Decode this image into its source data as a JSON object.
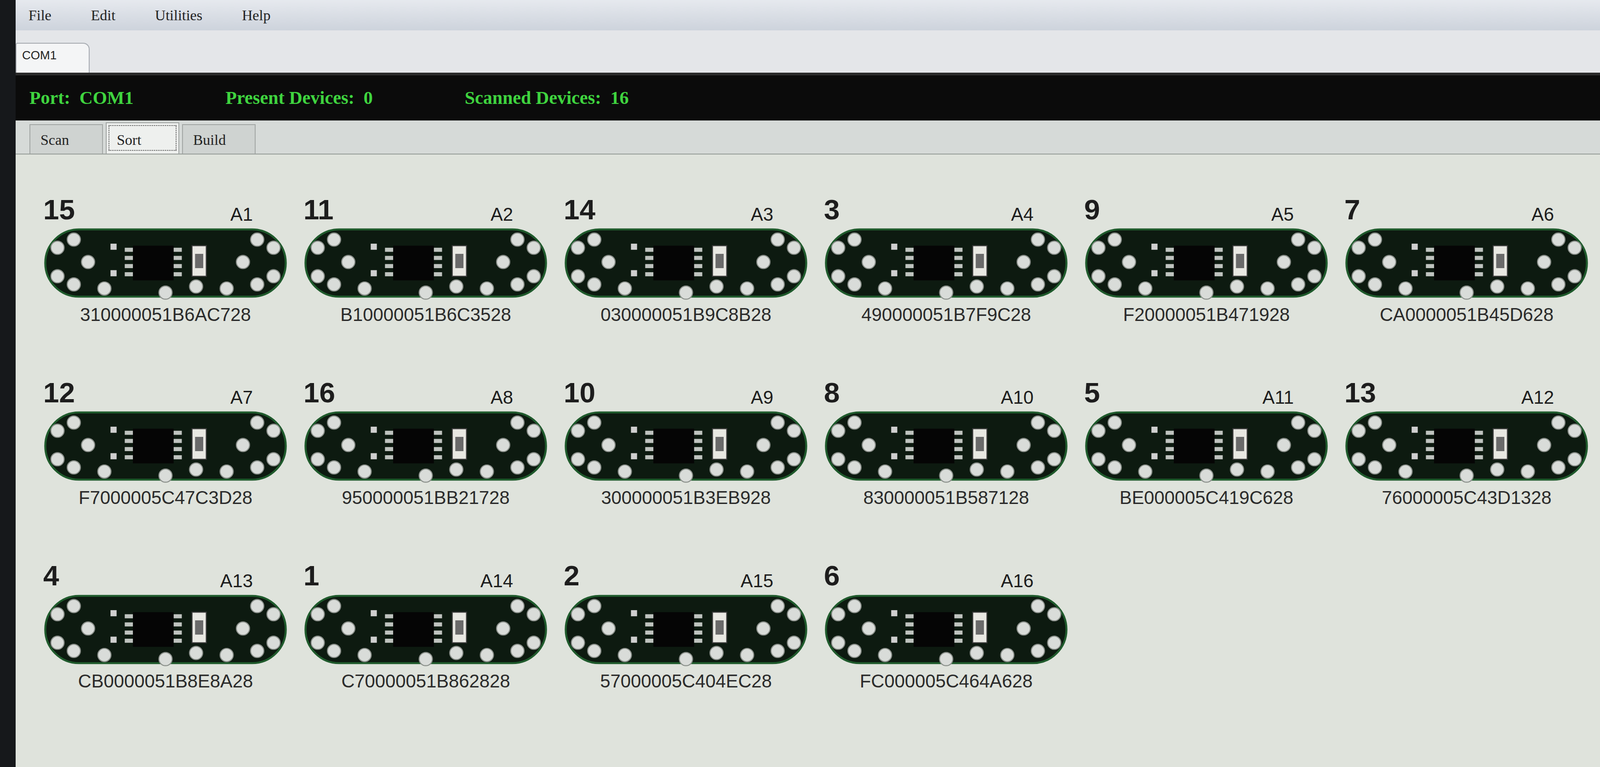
{
  "menu": [
    "File",
    "Edit",
    "Utilities",
    "Help"
  ],
  "port_tabs": [
    {
      "label": "COM1",
      "selected": true
    }
  ],
  "status_bar": [
    {
      "label": "Port:",
      "value": "COM1"
    },
    {
      "label": "Present Devices:",
      "value": "0"
    },
    {
      "label": "Scanned Devices:",
      "value": "16"
    }
  ],
  "tabs": [
    {
      "label": "Scan",
      "selected": false
    },
    {
      "label": "Sort",
      "selected": true
    },
    {
      "label": "Build",
      "selected": false
    }
  ],
  "devices": [
    {
      "number": "15",
      "slot": "A1",
      "id": "310000051B6AC728"
    },
    {
      "number": "11",
      "slot": "A2",
      "id": "B10000051B6C3528"
    },
    {
      "number": "14",
      "slot": "A3",
      "id": "030000051B9C8B28"
    },
    {
      "number": "3",
      "slot": "A4",
      "id": "490000051B7F9C28"
    },
    {
      "number": "9",
      "slot": "A5",
      "id": "F20000051B471928"
    },
    {
      "number": "7",
      "slot": "A6",
      "id": "CA0000051B45D628"
    },
    {
      "number": "12",
      "slot": "A7",
      "id": "F7000005C47C3D28"
    },
    {
      "number": "16",
      "slot": "A8",
      "id": "950000051BB21728"
    },
    {
      "number": "10",
      "slot": "A9",
      "id": "300000051B3EB928"
    },
    {
      "number": "8",
      "slot": "A10",
      "id": "830000051B587128"
    },
    {
      "number": "5",
      "slot": "A11",
      "id": "BE000005C419C628"
    },
    {
      "number": "13",
      "slot": "A12",
      "id": "76000005C43D1328"
    },
    {
      "number": "4",
      "slot": "A13",
      "id": "CB0000051B8E8A28"
    },
    {
      "number": "1",
      "slot": "A14",
      "id": "C70000051B862828"
    },
    {
      "number": "2",
      "slot": "A15",
      "id": "57000005C404EC28"
    },
    {
      "number": "6",
      "slot": "A16",
      "id": "FC000005C464A628"
    }
  ]
}
